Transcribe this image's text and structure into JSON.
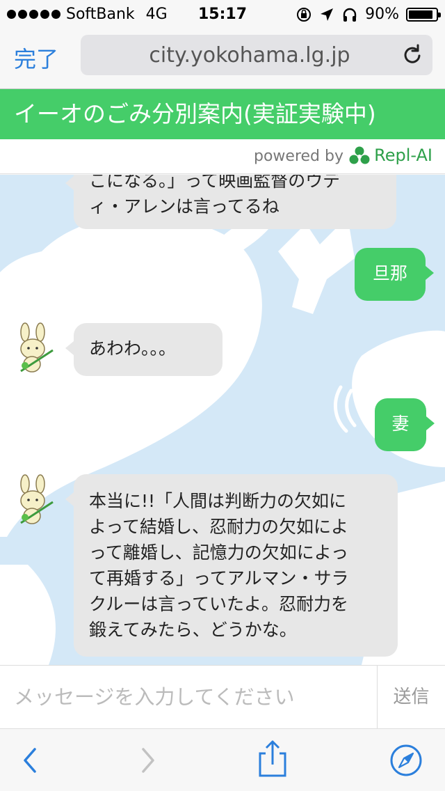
{
  "status_bar": {
    "carrier": "SoftBank",
    "network": "4G",
    "time": "15:17",
    "battery": "90%",
    "battery_level": 0.9
  },
  "browser": {
    "done_label": "完了",
    "url": "city.yokohama.lg.jp"
  },
  "header": {
    "title": "イーオのごみ分別案内(実証実験中)",
    "powered_by": "powered by",
    "brand": "Repl-AI"
  },
  "messages": [
    {
      "side": "bot",
      "lines": [
        "こになる。」って映画監督のウデ",
        "ィ・アレンは言ってるね"
      ]
    },
    {
      "side": "user",
      "lines": [
        "旦那"
      ]
    },
    {
      "side": "bot",
      "lines": [
        "あわわ。。。"
      ]
    },
    {
      "side": "user",
      "lines": [
        "妻"
      ]
    },
    {
      "side": "bot",
      "lines": [
        "本当に!!「人間は判断力の欠如に",
        "よって結婚し、忍耐力の欠如によ",
        "って離婚し、記憶力の欠如によっ",
        "て再婚する」ってアルマン・サラ",
        "クルーは言っていたよ。忍耐力を",
        "鍛えてみたら、どうかな。"
      ]
    }
  ],
  "input": {
    "placeholder": "メッセージを入力してください",
    "send_label": "送信"
  },
  "colors": {
    "accent_green": "#45cd69",
    "link_blue": "#2b7fdc",
    "chat_bg": "#d4e8f7"
  }
}
